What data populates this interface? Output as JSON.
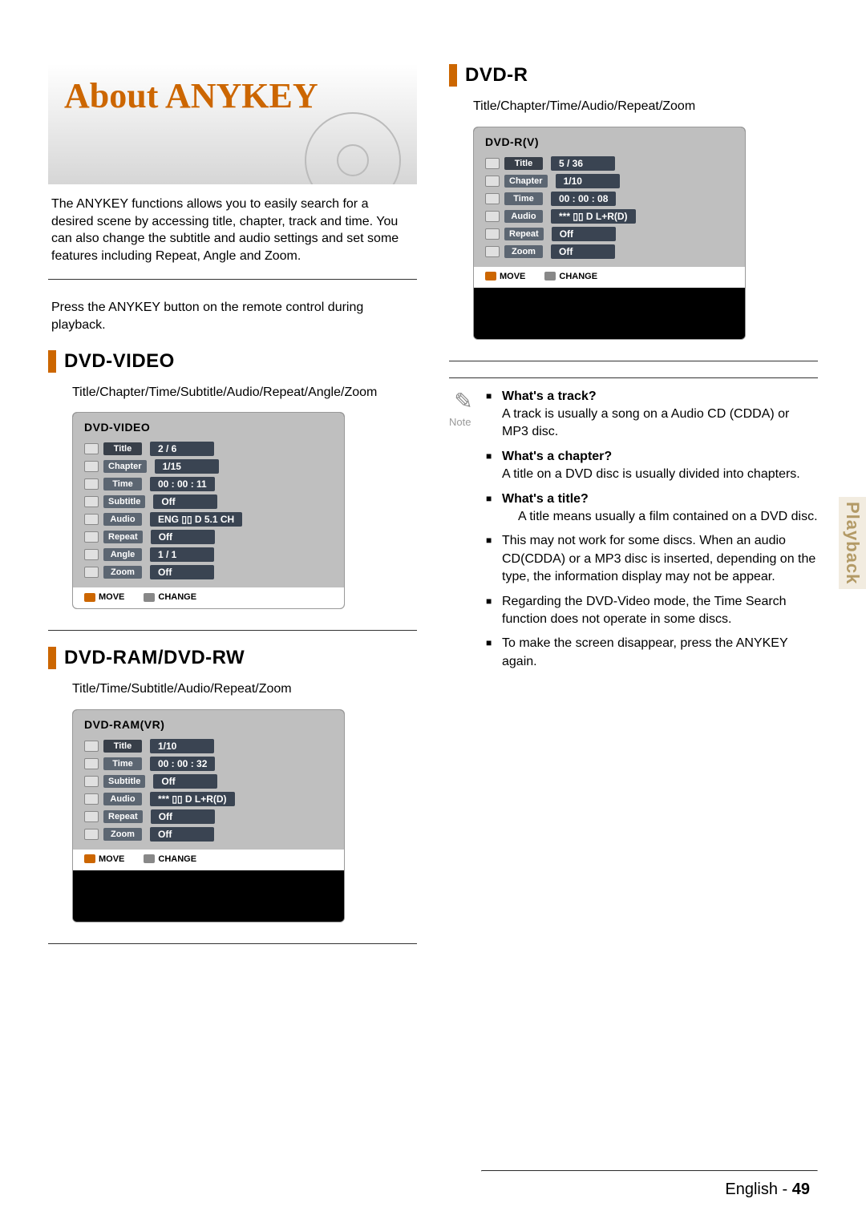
{
  "title_block": {
    "heading": "About ANYKEY",
    "intro": "The ANYKEY functions allows you to easily search for a desired scene by accessing title, chapter, track and time. You can also change the subtitle and audio settings and set some features including Repeat, Angle and Zoom.",
    "press": "Press the ANYKEY button on the remote control during playback."
  },
  "sections": {
    "dvd_video": {
      "title": "DVD-VIDEO",
      "sub": "Title/Chapter/Time/Subtitle/Audio/Repeat/Angle/Zoom",
      "osd": {
        "title": "DVD-VIDEO",
        "rows": [
          {
            "label": "Title",
            "value": "2 / 6"
          },
          {
            "label": "Chapter",
            "value": "1/15"
          },
          {
            "label": "Time",
            "value": "00 : 00 : 11"
          },
          {
            "label": "Subtitle",
            "value": "Off"
          },
          {
            "label": "Audio",
            "value": "ENG ▯▯ D 5.1 CH"
          },
          {
            "label": "Repeat",
            "value": "Off"
          },
          {
            "label": "Angle",
            "value": "1 / 1"
          },
          {
            "label": "Zoom",
            "value": "Off"
          }
        ],
        "foot_move": "MOVE",
        "foot_change": "CHANGE"
      }
    },
    "dvd_ram": {
      "title": "DVD-RAM/DVD-RW",
      "sub": "Title/Time/Subtitle/Audio/Repeat/Zoom",
      "osd": {
        "title": "DVD-RAM(VR)",
        "rows": [
          {
            "label": "Title",
            "value": "1/10"
          },
          {
            "label": "Time",
            "value": "00 : 00 : 32"
          },
          {
            "label": "Subtitle",
            "value": "Off"
          },
          {
            "label": "Audio",
            "value": "*** ▯▯ D L+R(D)"
          },
          {
            "label": "Repeat",
            "value": "Off"
          },
          {
            "label": "Zoom",
            "value": "Off"
          }
        ],
        "foot_move": "MOVE",
        "foot_change": "CHANGE"
      }
    },
    "dvd_r": {
      "title": "DVD-R",
      "sub": "Title/Chapter/Time/Audio/Repeat/Zoom",
      "osd": {
        "title": "DVD-R(V)",
        "rows": [
          {
            "label": "Title",
            "value": "5 / 36"
          },
          {
            "label": "Chapter",
            "value": "1/10"
          },
          {
            "label": "Time",
            "value": "00 : 00 : 08"
          },
          {
            "label": "Audio",
            "value": "*** ▯▯ D L+R(D)"
          },
          {
            "label": "Repeat",
            "value": "Off"
          },
          {
            "label": "Zoom",
            "value": "Off"
          }
        ],
        "foot_move": "MOVE",
        "foot_change": "CHANGE"
      }
    }
  },
  "note": {
    "label": "Note",
    "items": [
      {
        "head": "What's a track?",
        "body": "A track is usually a song on a Audio CD (CDDA) or MP3 disc."
      },
      {
        "head": "What's a chapter?",
        "body": "A title on a DVD disc is usually divided into chapters."
      },
      {
        "head": "What's a title?",
        "body": "A title means usually a film contained on a DVD disc.",
        "indent": true
      },
      {
        "body": "This may not work for some discs. When an audio CD(CDDA) or a MP3 disc is inserted, depending on the type, the information display may not be appear."
      },
      {
        "body": "Regarding the DVD-Video mode, the Time Search function does not operate in some discs."
      },
      {
        "body": "To make the screen disappear, press the ANYKEY again."
      }
    ]
  },
  "sidetab": "Playback",
  "footer": {
    "lang": "English -",
    "page": "49"
  }
}
